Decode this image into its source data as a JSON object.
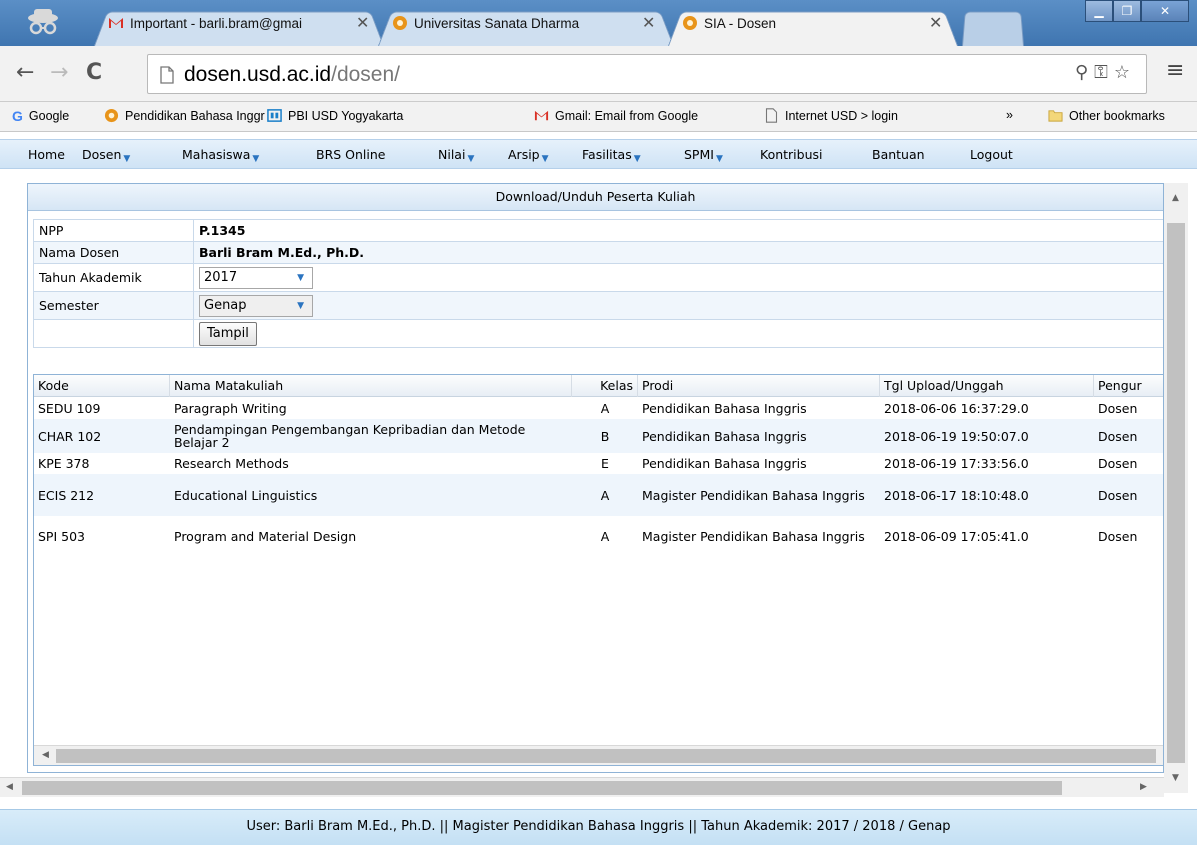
{
  "browser": {
    "tabs": [
      {
        "title": "Important - barli.bram@gmai",
        "icon": "gmail-icon"
      },
      {
        "title": "Universitas Sanata Dharma",
        "icon": "usd-favicon"
      },
      {
        "title": "SIA - Dosen",
        "icon": "usd-favicon",
        "active": true
      }
    ],
    "url_host": "dosen.usd.ac.id",
    "url_path": "/dosen/",
    "bookmarks": [
      {
        "label": "Google",
        "icon": "google-icon"
      },
      {
        "label": "Pendidikan Bahasa Inggr",
        "icon": "usd-favicon"
      },
      {
        "label": "PBI USD Yogyakarta",
        "icon": "site-icon"
      },
      {
        "label": "Gmail: Email from Google",
        "icon": "gmail-icon"
      },
      {
        "label": "Internet USD > login",
        "icon": "page-icon"
      }
    ],
    "bookmarks_overflow": "»",
    "other_bookmarks": "Other bookmarks"
  },
  "menu": {
    "home": "Home",
    "dosen": "Dosen",
    "mahasiswa": "Mahasiswa",
    "brs": "BRS Online",
    "nilai": "Nilai",
    "arsip": "Arsip",
    "fasilitas": "Fasilitas",
    "spmi": "SPMI",
    "kontribusi": "Kontribusi",
    "bantuan": "Bantuan",
    "logout": "Logout"
  },
  "panel": {
    "title": "Download/Unduh Peserta Kuliah",
    "npp_label": "NPP",
    "npp_value": "P.1345",
    "nama_label": "Nama Dosen",
    "nama_value": "Barli Bram M.Ed., Ph.D.",
    "tahun_label": "Tahun Akademik",
    "tahun_value": "2017",
    "semester_label": "Semester",
    "semester_value": "Genap",
    "tampil_button": "Tampil"
  },
  "grid": {
    "columns": [
      "Kode",
      "Nama Matakuliah",
      "Kelas",
      "Prodi",
      "Tgl Upload/Unggah",
      "Pengur"
    ],
    "rows": [
      {
        "kode": "SEDU 109",
        "nama": "Paragraph Writing",
        "kelas": "A",
        "prodi": "Pendidikan Bahasa Inggris",
        "tgl": "2018-06-06 16:37:29.0",
        "pengur": "Dosen"
      },
      {
        "kode": "CHAR 102",
        "nama": "Pendampingan Pengembangan Kepribadian dan Metode Belajar 2",
        "kelas": "B",
        "prodi": "Pendidikan Bahasa Inggris",
        "tgl": "2018-06-19 19:50:07.0",
        "pengur": "Dosen"
      },
      {
        "kode": "KPE 378",
        "nama": "Research Methods",
        "kelas": "E",
        "prodi": "Pendidikan Bahasa Inggris",
        "tgl": "2018-06-19 17:33:56.0",
        "pengur": "Dosen"
      },
      {
        "kode": "ECIS 212",
        "nama": "Educational Linguistics",
        "kelas": "A",
        "prodi": "Magister Pendidikan Bahasa Inggris",
        "tgl": "2018-06-17 18:10:48.0",
        "pengur": "Dosen"
      },
      {
        "kode": "SPI 503",
        "nama": "Program and Material Design",
        "kelas": "A",
        "prodi": "Magister Pendidikan Bahasa Inggris",
        "tgl": "2018-06-09 17:05:41.0",
        "pengur": "Dosen"
      }
    ]
  },
  "status": {
    "text": "User: Barli Bram M.Ed., Ph.D. || Magister Pendidikan Bahasa Inggris || Tahun Akademik: 2017 / 2018 / Genap"
  }
}
